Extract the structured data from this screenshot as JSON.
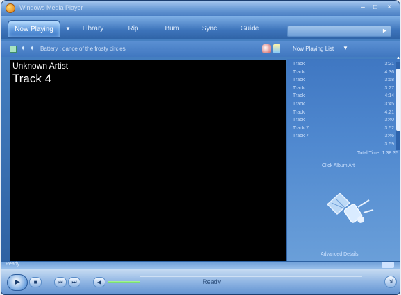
{
  "window": {
    "title": "Windows Media Player"
  },
  "window_controls": {
    "minimize": "–",
    "maximize": "□",
    "close": "×"
  },
  "tabs": [
    {
      "label": "Now Playing"
    },
    {
      "label": "Library"
    },
    {
      "label": "Rip"
    },
    {
      "label": "Burn"
    },
    {
      "label": "Sync"
    },
    {
      "label": "Guide"
    }
  ],
  "subbar": {
    "visualization_text": "Battery : dance of the frosty circles",
    "now_playing_list": "Now Playing List"
  },
  "video": {
    "artist": "Unknown Artist",
    "track": "Track 4"
  },
  "playlist": {
    "items": [
      {
        "title": "Track",
        "duration": "3:21"
      },
      {
        "title": "Track",
        "duration": "4:36"
      },
      {
        "title": "Track",
        "duration": "3:58"
      },
      {
        "title": "Track",
        "duration": "3:27"
      },
      {
        "title": "Track",
        "duration": "4:14"
      },
      {
        "title": "Track",
        "duration": "3:45"
      },
      {
        "title": "Track",
        "duration": "4:21"
      },
      {
        "title": "Track",
        "duration": "3:40"
      },
      {
        "title": "Track 7",
        "duration": "3:52"
      },
      {
        "title": "Track 7",
        "duration": "3:46"
      },
      {
        "title": "",
        "duration": "3:59"
      }
    ],
    "total_time": "Total Time: 1:38:35",
    "album_art_label": "Click Album Art",
    "info_label": "Advanced Details"
  },
  "status": {
    "left_text": "Ready"
  },
  "controls": {
    "play": "▶",
    "stop": "■",
    "prev": "⏮",
    "next": "⏭",
    "mute": "◀",
    "status_label": "Ready",
    "resize": "⇲"
  },
  "colors": {
    "accent": "#3d74bb",
    "video_bg": "#000000",
    "volume": "#3fbf4f"
  }
}
